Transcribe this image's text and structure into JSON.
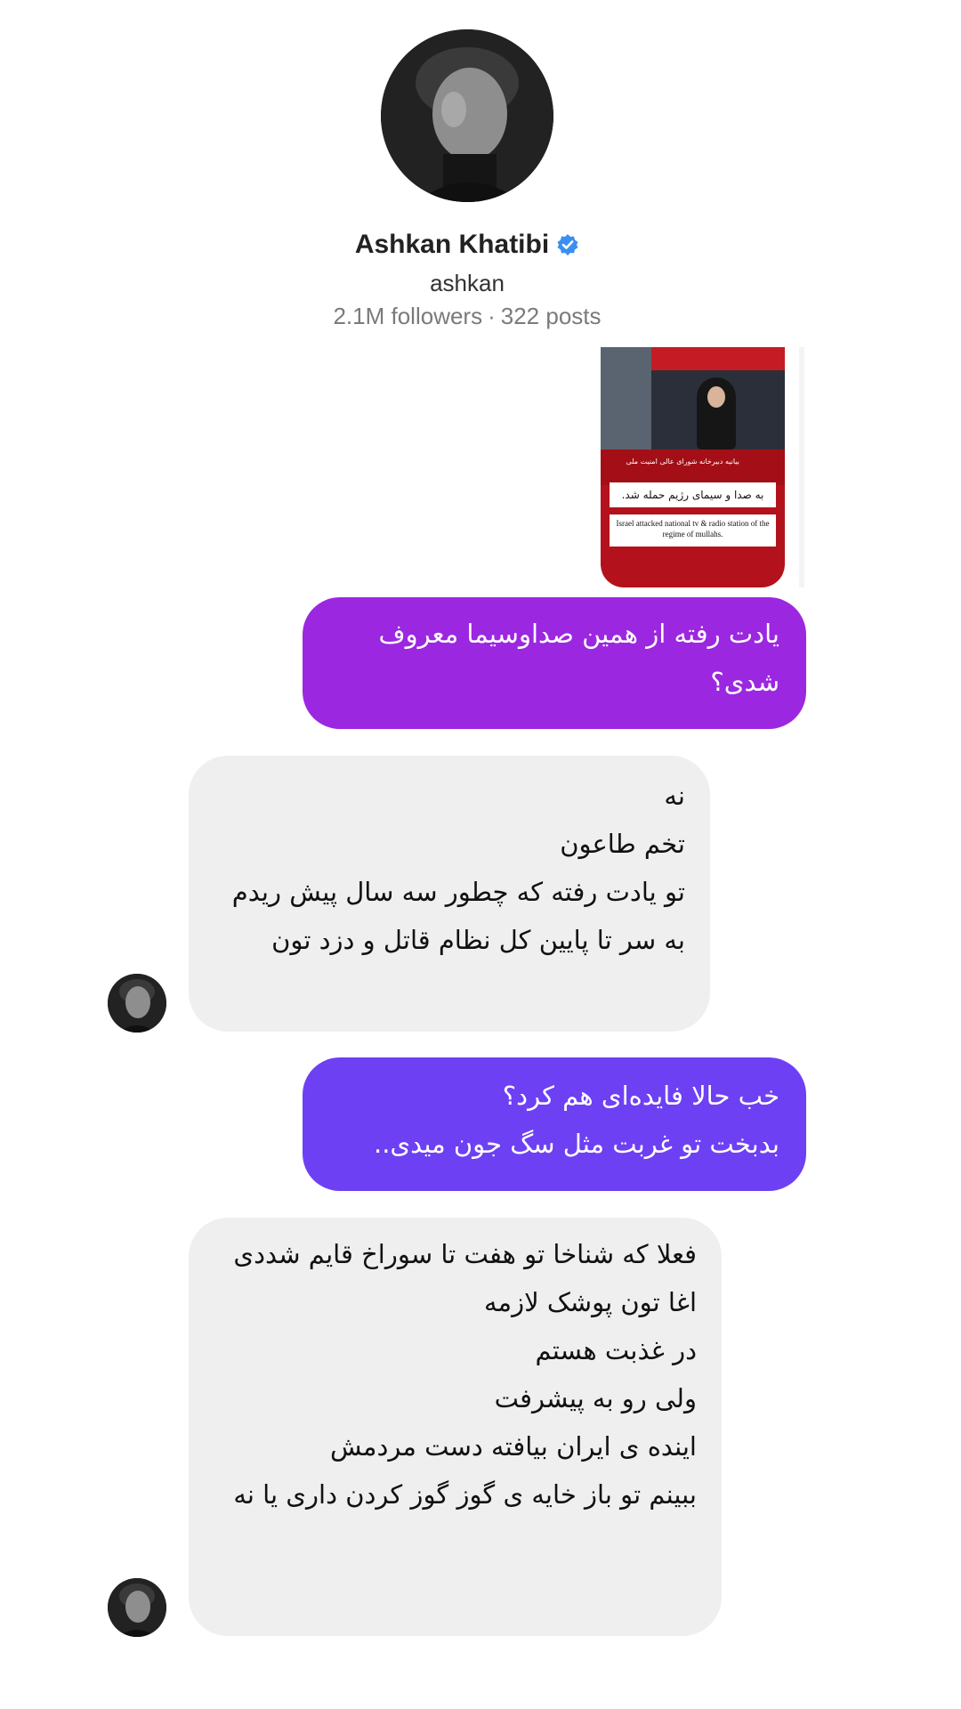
{
  "profile": {
    "name": "Ashkan Khatibi",
    "username": "ashkan",
    "followers": "2.1M followers",
    "separator": "·",
    "posts": "322 posts",
    "verified_icon": "verified-badge-icon",
    "verified_color": "#3b8ff0"
  },
  "shared_post": {
    "headline_fa": "به صدا و سیمای رژیم حمله شد.",
    "headline_en": "Israel attacked national tv & radio station of the regime of mullahs.",
    "ticker_fa": "بیانیه دبیرخانه شورای عالی امنیت ملی"
  },
  "messages": [
    {
      "direction": "sent",
      "color": "#9c27e0",
      "text": "یادت رفته از همین صداوسیما معروف شدی؟"
    },
    {
      "direction": "received",
      "text": "نه\nتخم طاعون\nتو یادت رفته که چطور  سه سال پیش ریدم به سر تا پایین کل نظام قاتل و دزد تون"
    },
    {
      "direction": "sent",
      "color": "#6d40f4",
      "text": "خب حالا فایده‌ای هم کرد؟\nبدبخت تو غربت مثل سگ جون میدی.."
    },
    {
      "direction": "received",
      "text": "فعلا که شناخا تو هفت تا سوراخ قایم شددی\nاغا تون پوشک لازمه\nدر غذبت هستم\nولی رو به پیشرفت\nاینده ی ایران بیافته دست مردمش\nببینم تو باز خایه ی گوز گوز کردن داری یا نه"
    }
  ]
}
